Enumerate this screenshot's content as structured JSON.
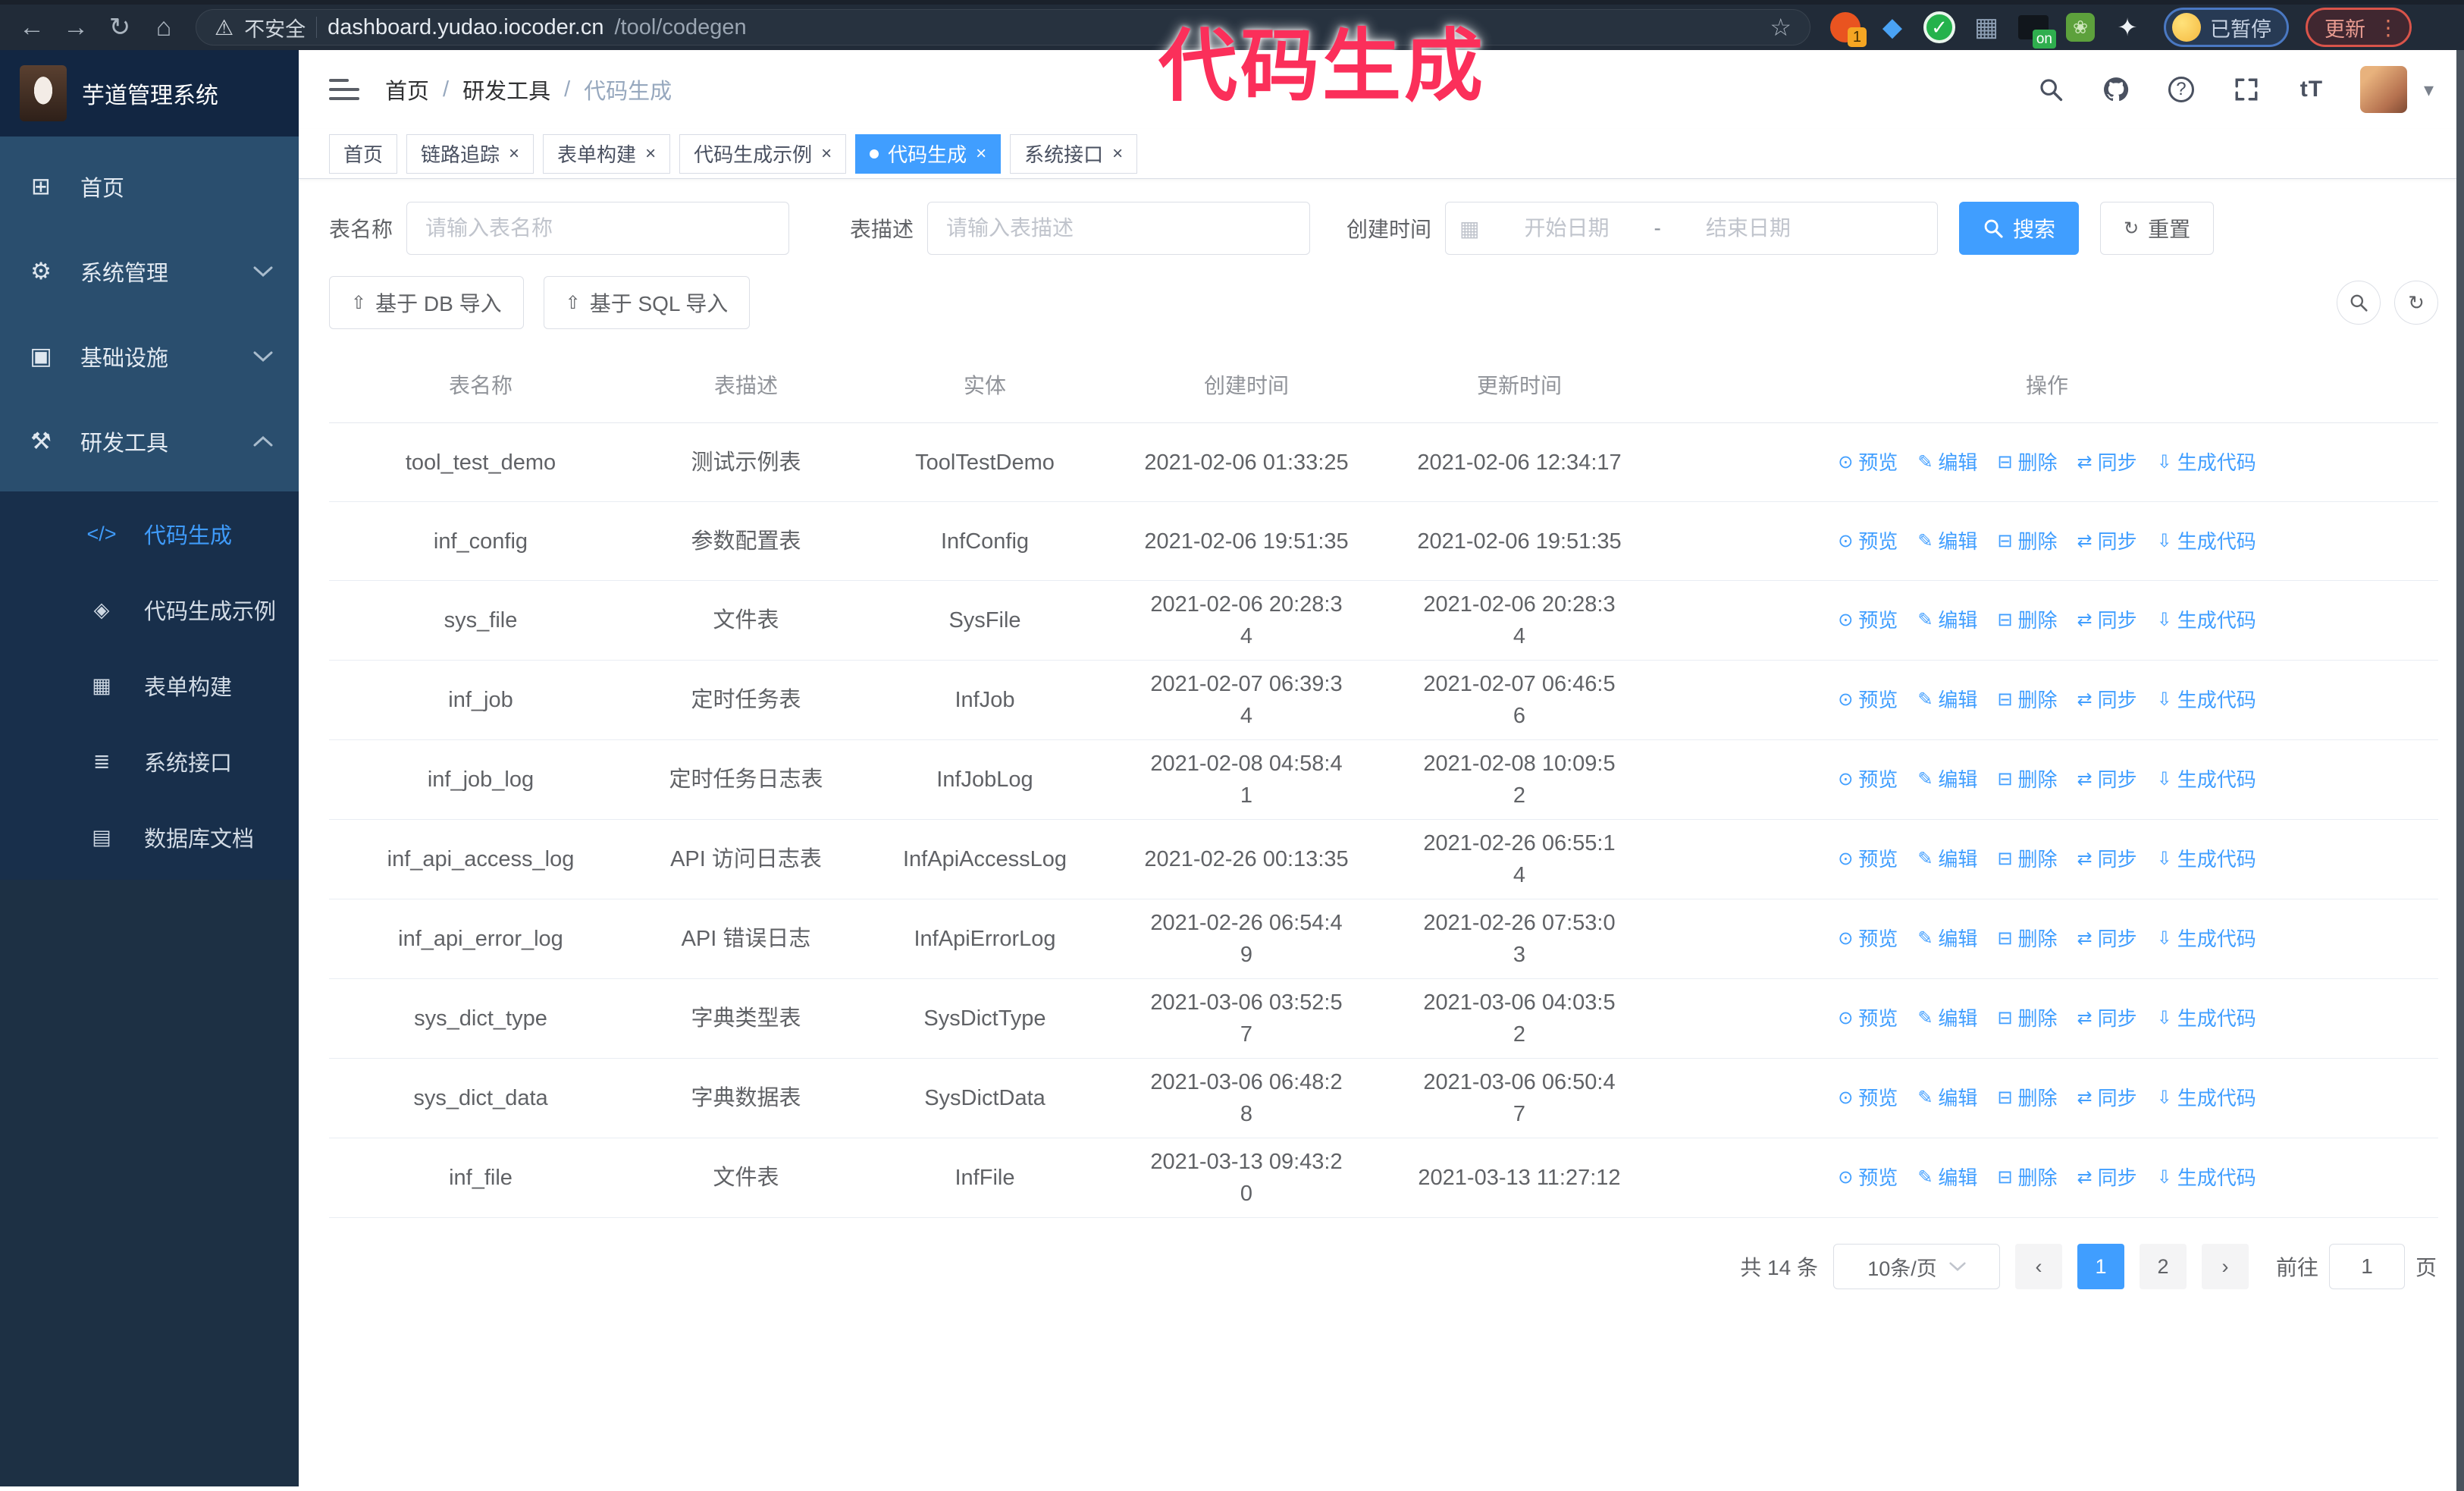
{
  "browser": {
    "security_warning": "不安全",
    "url_host": "dashboard.yudao.iocoder.cn",
    "url_path": "/tool/codegen",
    "extension_badge_count": "1",
    "extension_badge_on": "on",
    "profile_badge": "已暂停",
    "update_button": "更新"
  },
  "watermark": "代码生成",
  "icons": {
    "back": "←",
    "forward": "→",
    "reload": "↻",
    "home": "⌂",
    "warning": "⚠",
    "star": "☆",
    "kebab": "⋮",
    "caret_down": "▾",
    "close": "×",
    "gem": "◆",
    "check": "✓",
    "grid": "▦",
    "leaf": "❀",
    "puzzle": "✦",
    "calendar": "▦",
    "refresh": "↻",
    "upload": "⇧",
    "prev_arrow": "‹",
    "next_arrow": "›",
    "text_size": "tT",
    "question": "?"
  },
  "sidebar": {
    "logo_title": "芋道管理系统",
    "items": [
      {
        "label": "首页",
        "icon": "dashboard-icon",
        "glyph": "⊞"
      },
      {
        "label": "系统管理",
        "icon": "gear-icon",
        "glyph": "⚙",
        "state": "collapsed"
      },
      {
        "label": "基础设施",
        "icon": "monitor-icon",
        "glyph": "▣",
        "state": "collapsed"
      },
      {
        "label": "研发工具",
        "icon": "toolbox-icon",
        "glyph": "⚒",
        "state": "expanded"
      }
    ],
    "submenu": [
      {
        "label": "代码生成",
        "icon": "code-icon",
        "glyph": "</>",
        "active": true
      },
      {
        "label": "代码生成示例",
        "icon": "demo-icon",
        "glyph": "◈",
        "active": false
      },
      {
        "label": "表单构建",
        "icon": "form-build-icon",
        "glyph": "▦",
        "active": false
      },
      {
        "label": "系统接口",
        "icon": "api-icon",
        "glyph": "≣",
        "active": false
      },
      {
        "label": "数据库文档",
        "icon": "db-doc-icon",
        "glyph": "▤",
        "active": false
      }
    ]
  },
  "header": {
    "breadcrumb": [
      "首页",
      "研发工具",
      "代码生成"
    ],
    "breadcrumb_separator": "/"
  },
  "tabs": [
    {
      "label": "首页",
      "closable": false,
      "active": false
    },
    {
      "label": "链路追踪",
      "closable": true,
      "active": false
    },
    {
      "label": "表单构建",
      "closable": true,
      "active": false
    },
    {
      "label": "代码生成示例",
      "closable": true,
      "active": false
    },
    {
      "label": "代码生成",
      "closable": true,
      "active": true
    },
    {
      "label": "系统接口",
      "closable": true,
      "active": false
    }
  ],
  "filters": {
    "table_name_label": "表名称",
    "table_name_placeholder": "请输入表名称",
    "table_desc_label": "表描述",
    "table_desc_placeholder": "请输入表描述",
    "create_time_label": "创建时间",
    "date_start_placeholder": "开始日期",
    "date_separator": "-",
    "date_end_placeholder": "结束日期",
    "search_button": "搜索",
    "reset_button": "重置"
  },
  "toolbar": {
    "import_db_button": "基于 DB 导入",
    "import_sql_button": "基于 SQL 导入"
  },
  "table": {
    "columns": [
      "表名称",
      "表描述",
      "实体",
      "创建时间",
      "更新时间",
      "操作"
    ],
    "actions": [
      {
        "label": "预览",
        "icon": "preview-eye-icon",
        "glyph": "⊙"
      },
      {
        "label": "编辑",
        "icon": "edit-pencil-icon",
        "glyph": "✎"
      },
      {
        "label": "删除",
        "icon": "delete-trash-icon",
        "glyph": "⊟"
      },
      {
        "label": "同步",
        "icon": "sync-icon",
        "glyph": "⇄"
      },
      {
        "label": "生成代码",
        "icon": "generate-code-download-icon",
        "glyph": "⇩"
      }
    ],
    "rows": [
      {
        "name": "tool_test_demo",
        "desc": "测试示例表",
        "entity": "ToolTestDemo",
        "create_time": "2021-02-06 01:33:25",
        "create_wrap": false,
        "update_time": "2021-02-06 12:34:17",
        "update_wrap": false
      },
      {
        "name": "inf_config",
        "desc": "参数配置表",
        "entity": "InfConfig",
        "create_time": "2021-02-06 19:51:35",
        "create_wrap": false,
        "update_time": "2021-02-06 19:51:35",
        "update_wrap": false
      },
      {
        "name": "sys_file",
        "desc": "文件表",
        "entity": "SysFile",
        "create_time": "2021-02-06 20:28:34",
        "create_wrap": true,
        "update_time": "2021-02-06 20:28:34",
        "update_wrap": true
      },
      {
        "name": "inf_job",
        "desc": "定时任务表",
        "entity": "InfJob",
        "create_time": "2021-02-07 06:39:34",
        "create_wrap": true,
        "update_time": "2021-02-07 06:46:56",
        "update_wrap": true
      },
      {
        "name": "inf_job_log",
        "desc": "定时任务日志表",
        "entity": "InfJobLog",
        "create_time": "2021-02-08 04:58:41",
        "create_wrap": true,
        "update_time": "2021-02-08 10:09:52",
        "update_wrap": true
      },
      {
        "name": "inf_api_access_log",
        "desc": "API 访问日志表",
        "entity": "InfApiAccessLog",
        "create_time": "2021-02-26 00:13:35",
        "create_wrap": false,
        "update_time": "2021-02-26 06:55:14",
        "update_wrap": true
      },
      {
        "name": "inf_api_error_log",
        "desc": "API 错误日志",
        "entity": "InfApiErrorLog",
        "create_time": "2021-02-26 06:54:49",
        "create_wrap": true,
        "update_time": "2021-02-26 07:53:03",
        "update_wrap": true
      },
      {
        "name": "sys_dict_type",
        "desc": "字典类型表",
        "entity": "SysDictType",
        "create_time": "2021-03-06 03:52:57",
        "create_wrap": true,
        "update_time": "2021-03-06 04:03:52",
        "update_wrap": true
      },
      {
        "name": "sys_dict_data",
        "desc": "字典数据表",
        "entity": "SysDictData",
        "create_time": "2021-03-06 06:48:28",
        "create_wrap": true,
        "update_time": "2021-03-06 06:50:47",
        "update_wrap": true
      },
      {
        "name": "inf_file",
        "desc": "文件表",
        "entity": "InfFile",
        "create_time": "2021-03-13 09:43:20",
        "create_wrap": true,
        "update_time": "2021-03-13 11:27:12",
        "update_wrap": false
      }
    ]
  },
  "pagination": {
    "total_text": "共 14 条",
    "page_size": "10条/页",
    "pages": [
      "1",
      "2"
    ],
    "active_page": "1",
    "goto_label": "前往",
    "goto_value": "1",
    "goto_suffix": "页"
  },
  "colors": {
    "accent_blue": "#409EFF",
    "watermark_pink": "#fb2f5a",
    "sidebar_dark": "#1d3044",
    "sidebar_menu": "#2a4e6e",
    "sidebar_submenu": "#182f4b",
    "chrome_dark": "#212b38"
  }
}
